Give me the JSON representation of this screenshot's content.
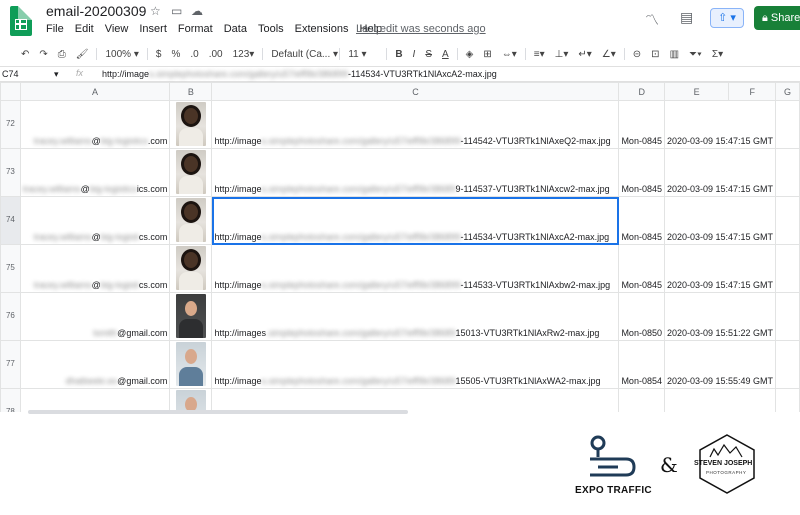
{
  "app": {
    "doc_title": "email-20200309",
    "menu": [
      "File",
      "Edit",
      "View",
      "Insert",
      "Format",
      "Data",
      "Tools",
      "Extensions",
      "Help"
    ],
    "last_edit": "Last edit was seconds ago",
    "share_label": "Share"
  },
  "toolbar": {
    "zoom": "100%",
    "currency": "$",
    "percent": "%",
    "dec_less": ".0",
    "dec_more": ".00",
    "more_formats": "123",
    "font": "Default (Ca...",
    "font_size": "11",
    "bold": "B",
    "italic": "I",
    "strike": "S",
    "text_color": "A",
    "sigma": "Σ"
  },
  "formula_bar": {
    "cell_ref": "C74",
    "fx": "fx",
    "value": "http://image████████████████████-114534-VTU3RTk1NlAxcA2-max.jpg"
  },
  "columns": [
    "A",
    "B",
    "C",
    "D",
    "E",
    "F",
    "G"
  ],
  "rows": [
    {
      "num": "72",
      "email_blur": "tracey.williams",
      "email_blur2": "big-logistics",
      "email_tail": ".com",
      "photo": "f",
      "url_head": "http://image",
      "url_blur": "s.simplephotoshare.com/gallery/u57/eff9b/386899",
      "url_tail": "-114542-VTU3RTk1NlAxeQ2-max.jpg",
      "d": "Mon-0845",
      "e": "2020-03-09 15:47:15 GMT"
    },
    {
      "num": "73",
      "email_blur": "tracey.williams",
      "email_blur2": "big-logistics",
      "email_tail": "ics.com",
      "photo": "f",
      "url_head": "http://image",
      "url_blur": "s.simplephotoshare.com/gallery/u57/eff9b/38689",
      "url_tail": "9-114537-VTU3RTk1NlAxcw2-max.jpg",
      "d": "Mon-0845",
      "e": "2020-03-09 15:47:15 GMT"
    },
    {
      "num": "74",
      "email_blur": "tracey.williams",
      "email_blur2": "big-logisti",
      "email_tail": "cs.com",
      "photo": "f",
      "url_head": "http://image",
      "url_blur": "s.simplephotoshare.com/gallery/u57/eff9b/386899",
      "url_tail": "-114534-VTU3RTk1NlAxcA2-max.jpg",
      "d": "Mon-0845",
      "e": "2020-03-09 15:47:15 GMT"
    },
    {
      "num": "75",
      "email_blur": "tracey.williams",
      "email_blur2": "big-logisti",
      "email_tail": "cs.com",
      "photo": "f",
      "url_head": "http://image",
      "url_blur": "s.simplephotoshare.com/gallery/u57/eff9b/386899",
      "url_tail": "-114533-VTU3RTk1NlAxbw2-max.jpg",
      "d": "Mon-0845",
      "e": "2020-03-09 15:47:15 GMT"
    },
    {
      "num": "76",
      "email_blur": "tsmith",
      "email_blur2": "",
      "email_tail": "gmail.com",
      "photo": "m",
      "url_head": "http://images",
      "url_blur": ".simplephotoshare.com/gallery/u57/eff9b/38689",
      "url_tail": "15013-VTU3RTk1NlAxRw2-max.jpg",
      "d": "Mon-0850",
      "e": "2020-03-09 15:51:22 GMT"
    },
    {
      "num": "77",
      "email_blur": "dhatbeekr.es",
      "email_blur2": "",
      "email_tail": "gmail.com",
      "photo": "m2",
      "url_head": "http://image",
      "url_blur": "s.simplephotoshare.com/gallery/u57/eff9b/38689",
      "url_tail": "15505-VTU3RTk1NlAxWA2-max.jpg",
      "d": "Mon-0854",
      "e": "2020-03-09 15:55:49 GMT"
    },
    {
      "num": "78",
      "email_blur": "",
      "email_blur2": "",
      "email_tail": "",
      "photo": "m2",
      "url_head": "",
      "url_blur": "",
      "url_tail": "",
      "d": "",
      "e": ""
    }
  ],
  "logos": {
    "expo": "EXPO TRAFFIC",
    "amp": "&",
    "sj": "STEVEN JOSEPH",
    "sj_sub": "PHOTOGRAPHY"
  }
}
